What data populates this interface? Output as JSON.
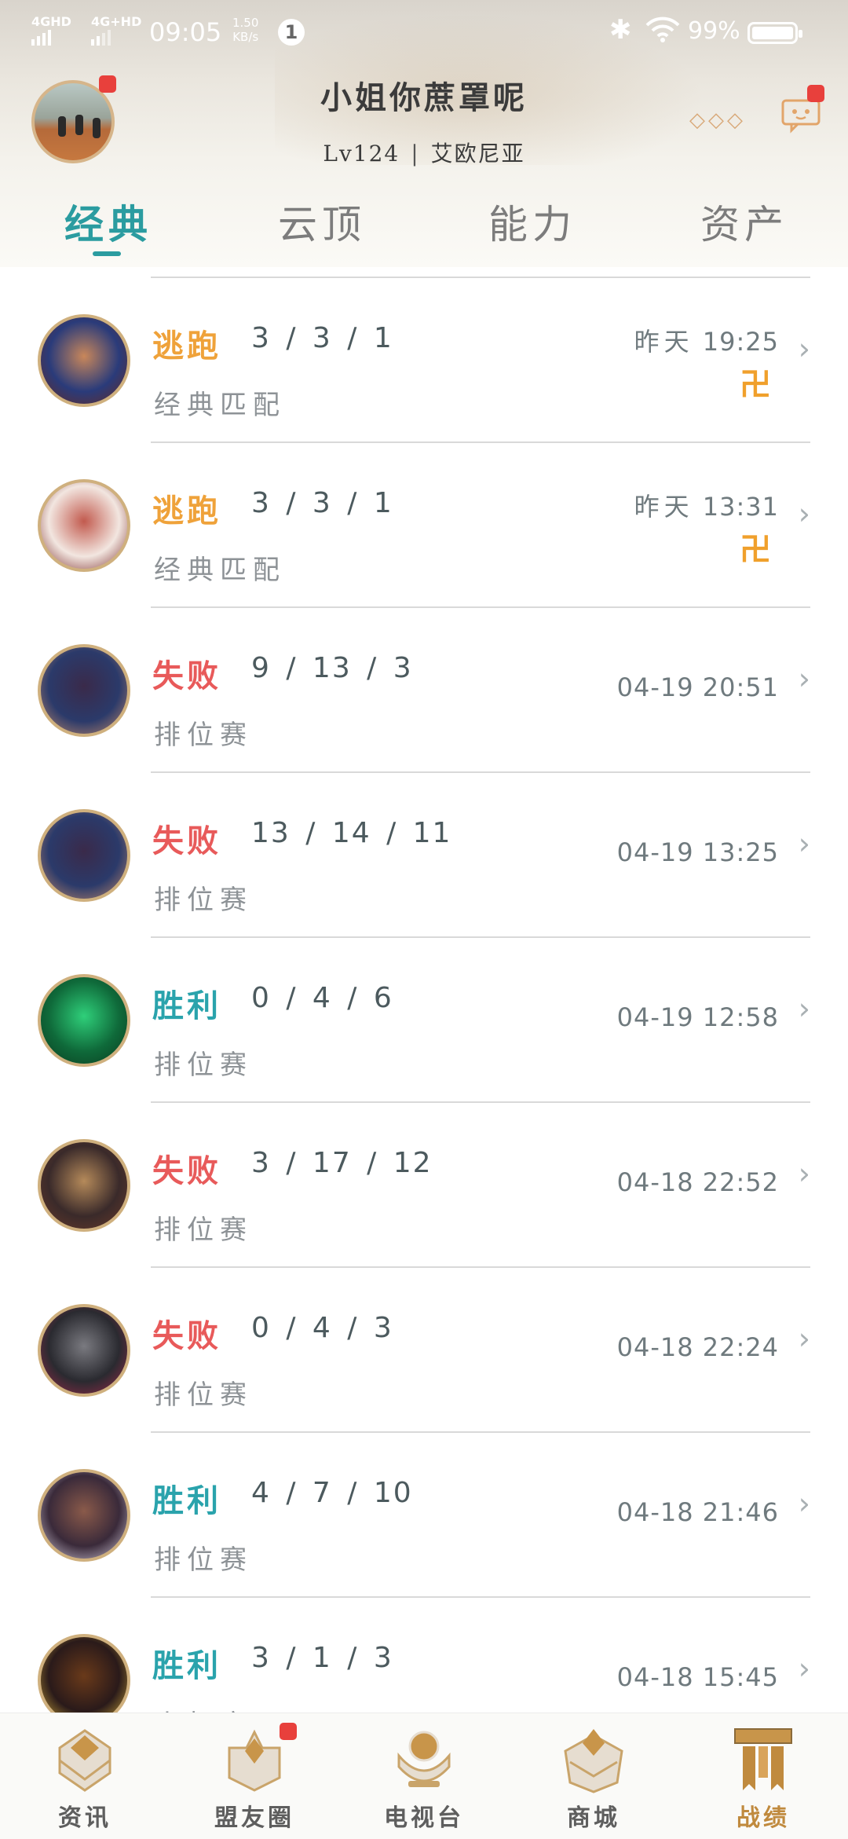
{
  "status_bar": {
    "signal1": "4GHD",
    "signal2": "4G+HD",
    "time": "09:05",
    "speed_value": "1.50",
    "speed_unit": "KB/s",
    "notification_count": "1",
    "battery": "99%"
  },
  "profile": {
    "name": "小姐你蔗罩呢",
    "level": "Lv124",
    "separator": "|",
    "region": "艾欧尼亚"
  },
  "tabs": [
    {
      "label": "经典",
      "active": true
    },
    {
      "label": "云顶",
      "active": false
    },
    {
      "label": "能力",
      "active": false
    },
    {
      "label": "资产",
      "active": false
    }
  ],
  "matches": [
    {
      "result": "逃跑",
      "result_type": "flee",
      "kda": "3 / 3 / 1",
      "mode": "经典匹配",
      "date": "昨天",
      "time": "19:25",
      "flee_icon": "卍",
      "hero_colors": [
        "#2a3b7a",
        "#c9875a",
        "#6a2a20"
      ]
    },
    {
      "result": "逃跑",
      "result_type": "flee",
      "kda": "3 / 3 / 1",
      "mode": "经典匹配",
      "date": "昨天",
      "time": "13:31",
      "flee_icon": "卍",
      "hero_colors": [
        "#f2e6e0",
        "#c25a4e",
        "#7a2a2a"
      ]
    },
    {
      "result": "失败",
      "result_type": "lose",
      "kda": "9 / 13 / 3",
      "mode": "排位赛",
      "date": "04-19",
      "time": "20:51",
      "hero_colors": [
        "#2b3a6a",
        "#3a2a4a",
        "#c58b6a"
      ]
    },
    {
      "result": "失败",
      "result_type": "lose",
      "kda": "13 / 14 / 11",
      "mode": "排位赛",
      "date": "04-19",
      "time": "13:25",
      "hero_colors": [
        "#2b3a6a",
        "#3a2a4a",
        "#c58b6a"
      ]
    },
    {
      "result": "胜利",
      "result_type": "win",
      "kda": "0 / 4 / 6",
      "mode": "排位赛",
      "date": "04-19",
      "time": "12:58",
      "hero_colors": [
        "#0f6a3a",
        "#2fcf7a",
        "#0a3a1f"
      ]
    },
    {
      "result": "失败",
      "result_type": "lose",
      "kda": "3 / 17 / 12",
      "mode": "排位赛",
      "date": "04-18",
      "time": "22:52",
      "hero_colors": [
        "#3a2a2a",
        "#b58a5a",
        "#6a3a2a"
      ]
    },
    {
      "result": "失败",
      "result_type": "lose",
      "kda": "0 / 4 / 3",
      "mode": "排位赛",
      "date": "04-18",
      "time": "22:24",
      "hero_colors": [
        "#2a2a30",
        "#7a7a80",
        "#a02a4a"
      ]
    },
    {
      "result": "胜利",
      "result_type": "win",
      "kda": "4 / 7 / 10",
      "mode": "排位赛",
      "date": "04-18",
      "time": "21:46",
      "hero_colors": [
        "#3a2a3a",
        "#8a5a4a",
        "#d8d0e0"
      ]
    },
    {
      "result": "胜利",
      "result_type": "win",
      "kda": "3 / 1 / 3",
      "mode": "人机赛",
      "date": "04-18",
      "time": "15:45",
      "hero_colors": [
        "#2a1a1a",
        "#6a3a1a",
        "#d8b03a"
      ]
    }
  ],
  "bottom_nav": [
    {
      "label": "资讯",
      "icon": "news-icon",
      "badge": false,
      "active": false
    },
    {
      "label": "盟友圈",
      "icon": "friends-icon",
      "badge": true,
      "active": false
    },
    {
      "label": "电视台",
      "icon": "tv-icon",
      "badge": false,
      "active": false
    },
    {
      "label": "商城",
      "icon": "store-icon",
      "badge": false,
      "active": false
    },
    {
      "label": "战绩",
      "icon": "record-icon",
      "badge": false,
      "active": true
    }
  ],
  "colors": {
    "accent": "#2b9ca0",
    "win": "#2aa3ac",
    "lose": "#e85a5a",
    "flee": "#efa23a",
    "gold": "#c08a3e"
  }
}
